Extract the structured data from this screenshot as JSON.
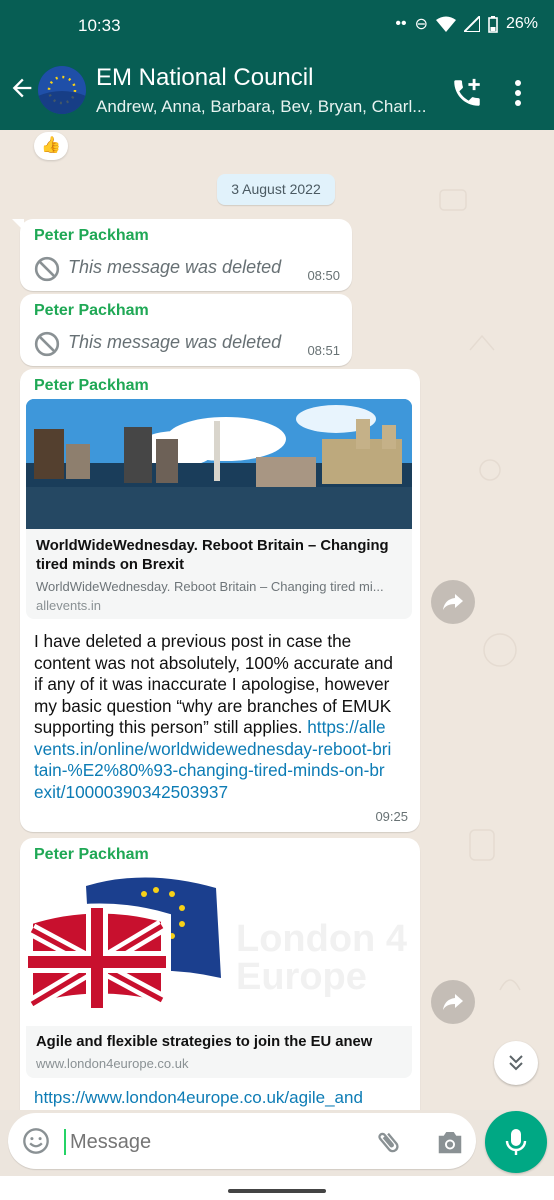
{
  "status": {
    "time": "10:33",
    "battery": "26%"
  },
  "header": {
    "title": "EM National Council",
    "subtitle": "Andrew, Anna, Barbara, Bev, Bryan, Charl..."
  },
  "reaction": "👍",
  "date_chip": "3 August 2022",
  "messages": [
    {
      "sender": "Peter Packham",
      "text": "This message was deleted",
      "time": "08:50"
    },
    {
      "sender": "Peter Packham",
      "text": "This message was deleted",
      "time": "08:51"
    },
    {
      "sender": "Peter Packham",
      "link_card": {
        "title": "WorldWideWednesday. Reboot Britain – Changing tired minds on Brexit",
        "description": "WorldWideWednesday. Reboot Britain – Changing tired mi...",
        "site": "allevents.in"
      },
      "text": "I have deleted a previous post in case the content was not absolutely, 100% accurate and if any of it was inaccurate I apologise, however my basic question “why are branches of EMUK supporting this person” still applies.",
      "link": "https://allevents.in/online/worldwidewednesday-reboot-britain-%E2%80%93-changing-tired-minds-on-brexit/10000390342503937",
      "time": "09:25"
    },
    {
      "sender": "Peter Packham",
      "link_card": {
        "title": "Agile and flexible strategies to join the EU anew",
        "site": "www.london4europe.co.uk",
        "watermark": "London 4\nEurope"
      },
      "link": "https://www.london4europe.co.uk/agile_and"
    }
  ],
  "composer": {
    "placeholder": "Message"
  },
  "icons": [
    "back-arrow-icon",
    "group-avatar",
    "add-call-icon",
    "more-vert-icon",
    "ban-icon",
    "share-icon",
    "chevron-double-down-icon",
    "emoji-icon",
    "attach-icon",
    "camera-icon",
    "mic-icon"
  ]
}
